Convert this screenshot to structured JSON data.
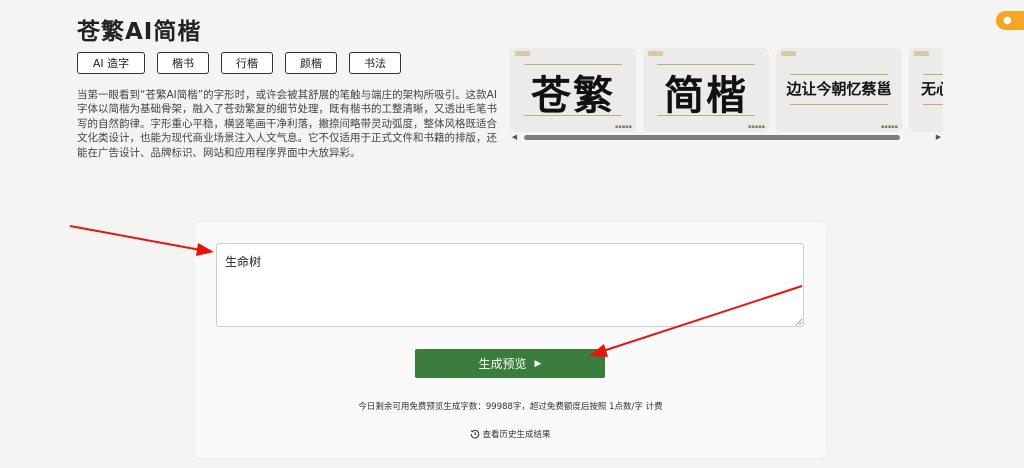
{
  "header": {
    "title": "苍繁AI简楷"
  },
  "tags": [
    "AI 造字",
    "楷书",
    "行楷",
    "颜楷",
    "书法"
  ],
  "description": "当第一眼看到“苍繁AI简楷”的字形时，或许会被其舒展的笔触与端庄的架构所吸引。这款AI字体以简楷为基础骨架，融入了苍劲繁复的细节处理，既有楷书的工整清晰，又透出毛笔书写的自然韵律。字形重心平稳，横竖笔画干净利落，撇捺间略带灵动弧度，整体风格既适合文化类设计，也能为现代商业场景注入人文气息。它不仅适用于正式文件和书籍的排版，还能在广告设计、品牌标识、网站和应用程序界面中大放异彩。",
  "gallery": [
    {
      "text": "苍繁"
    },
    {
      "text": "简楷"
    },
    {
      "text": "边让今朝忆蔡邕"
    },
    {
      "text": "无心"
    }
  ],
  "editor": {
    "value": "生命树",
    "generate_label": "生成预览",
    "quota_text": "今日剩余可用免费预览生成字数：99988字，超过免费额度后按照 1点数/字 计费",
    "history_label": "查看历史生成结果"
  },
  "colors": {
    "accent_green": "#3a7d3c",
    "badge_orange": "#f5a623",
    "annotation_red": "#e8140c"
  },
  "icons": {
    "generate": "play-triangle-icon",
    "history": "history-clock-icon"
  }
}
